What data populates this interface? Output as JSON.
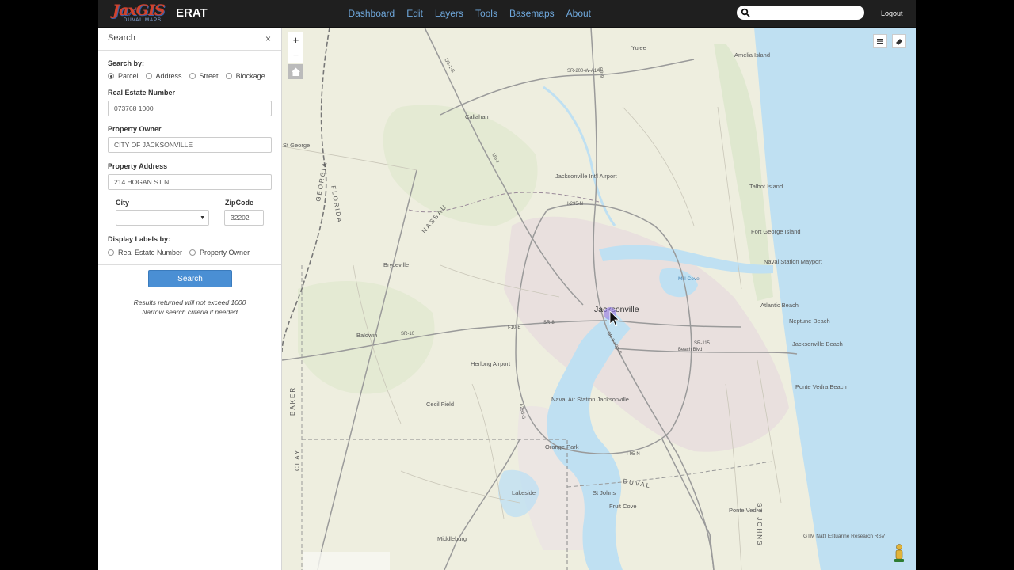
{
  "navbar": {
    "logo_text": "JaxGIS",
    "logo_sub": "DUVAL MAPS",
    "app_name": "ERAT",
    "menu": [
      "Dashboard",
      "Edit",
      "Layers",
      "Tools",
      "Basemaps",
      "About"
    ],
    "search_value": "",
    "logout_label": "Logout"
  },
  "sidebar": {
    "title": "Search",
    "close_glyph": "×",
    "search_by_label": "Search by:",
    "search_by_options": [
      "Parcel",
      "Address",
      "Street",
      "Blockage"
    ],
    "search_by_selected": "Parcel",
    "ren_label": "Real Estate Number",
    "ren_value": "073768 1000",
    "owner_label": "Property Owner",
    "owner_value": "CITY OF JACKSONVILLE",
    "address_label": "Property Address",
    "address_value": "214 HOGAN ST N",
    "city_label": "City",
    "city_value": "",
    "zip_label": "ZipCode",
    "zip_value": "32202",
    "display_labels_label": "Display Labels by:",
    "display_options": [
      "Real Estate Number",
      "Property Owner"
    ],
    "search_button": "Search",
    "note_line1": "Results returned will not exceed 1000",
    "note_line2": "Narrow search criteria if needed"
  },
  "map": {
    "zoom_in": "+",
    "zoom_out": "−",
    "colors": {
      "land": "#eeeedf",
      "water": "#bfe0f2",
      "urban": "#e8dede",
      "highway": "#9a9a9a",
      "state_line": "#777777"
    },
    "labels": [
      {
        "text": "Jacksonville",
        "major": true
      },
      {
        "text": "Yulee"
      },
      {
        "text": "Amelia Island"
      },
      {
        "text": "Callahan"
      },
      {
        "text": "St George"
      },
      {
        "text": "Jacksonville Int'l Airport"
      },
      {
        "text": "Talbot Island"
      },
      {
        "text": "Fort George Island"
      },
      {
        "text": "Naval Station Mayport"
      },
      {
        "text": "Atlantic Beach"
      },
      {
        "text": "Neptune Beach"
      },
      {
        "text": "Jacksonville Beach"
      },
      {
        "text": "Ponte Vedra Beach"
      },
      {
        "text": "Bryceville"
      },
      {
        "text": "Baldwin"
      },
      {
        "text": "Herlong Airport"
      },
      {
        "text": "Cecil Field"
      },
      {
        "text": "Naval Air Station Jacksonville"
      },
      {
        "text": "Orange Park"
      },
      {
        "text": "Lakeside"
      },
      {
        "text": "St Johns"
      },
      {
        "text": "Fruit Cove"
      },
      {
        "text": "Ponte Vedra"
      },
      {
        "text": "Middleburg"
      },
      {
        "text": "GTM Nat'l Estuarine Research RSV"
      },
      {
        "text": "Mill Cove"
      },
      {
        "text": "GEORGIA"
      },
      {
        "text": "FLORIDA"
      },
      {
        "text": "NASSAU"
      },
      {
        "text": "DUVAL"
      },
      {
        "text": "BAKER"
      },
      {
        "text": "CLAY"
      },
      {
        "text": "ST JOHNS"
      }
    ],
    "roads": [
      "I-295-N",
      "I-295-S",
      "I-10-E",
      "SR-8",
      "SR-9",
      "I-95-N",
      "SR-200-W-A1A",
      "US-1-S",
      "SR-9-I-95-S",
      "Beach Blvd",
      "US-1",
      "SR-10",
      "SR-115"
    ]
  }
}
